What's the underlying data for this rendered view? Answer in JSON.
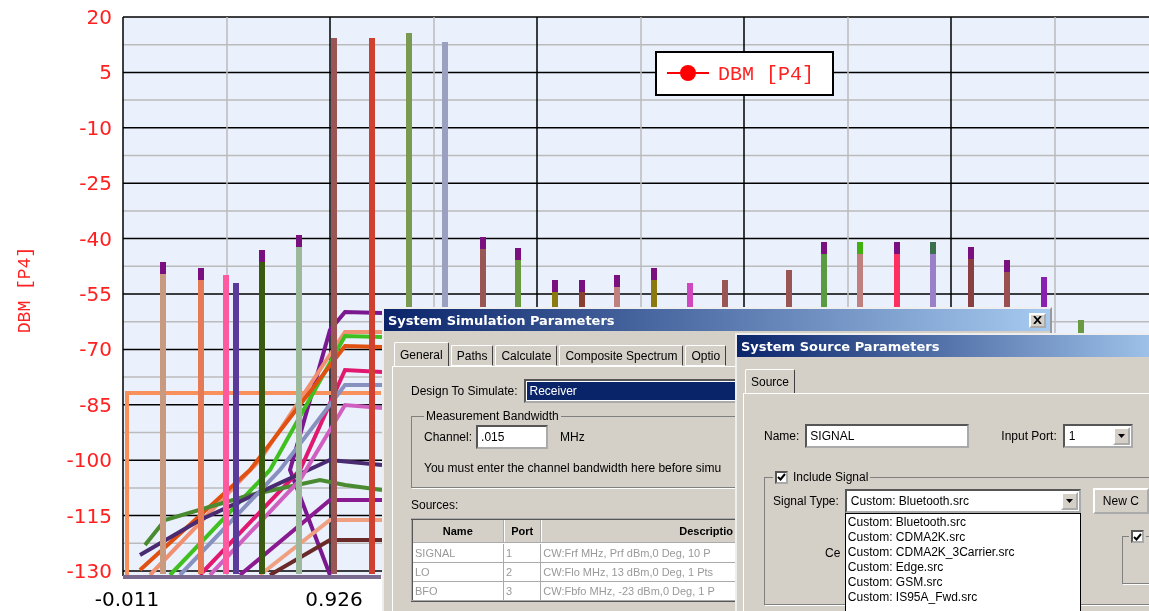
{
  "chart": {
    "y_axis_title": "DBM [P4]",
    "legend_label": "DBM [P4]",
    "y_ticks": [
      "20",
      "5",
      "-10",
      "-25",
      "-40",
      "-55",
      "-70",
      "-85",
      "-100",
      "-115",
      "-130"
    ],
    "x_ticks": [
      "-0.011",
      "0.926"
    ]
  },
  "simulation_dialog": {
    "title": "System Simulation Parameters",
    "tabs": [
      {
        "label": "General",
        "selected": true
      },
      {
        "label": "Paths",
        "selected": false
      },
      {
        "label": "Calculate",
        "selected": false
      },
      {
        "label": "Composite Spectrum",
        "selected": false
      },
      {
        "label": "Optio",
        "selected": false
      }
    ],
    "design_label": "Design To Simulate:",
    "design_value": "Receiver",
    "bandwidth_group": "Measurement Bandwidth",
    "channel_label": "Channel:",
    "channel_value": ".015",
    "channel_unit": "MHz",
    "note": "You must enter the channel bandwidth here before simu",
    "sources_label": "Sources:",
    "columns": [
      "Name",
      "Port",
      "Descriptio"
    ],
    "rows": [
      [
        "SIGNAL",
        "1",
        "CW:Frf MHz, Prf dBm,0 Deg, 10 P"
      ],
      [
        "LO",
        "2",
        "CW:Flo MHz, 13 dBm,0 Deg, 1 Pts"
      ],
      [
        "BFO",
        "3",
        "CW:Fbfo MHz, -23 dBm,0 Deg, 1 P"
      ]
    ]
  },
  "source_dialog": {
    "title": "System Source Parameters",
    "tabs": [
      {
        "label": "Source",
        "selected": true
      }
    ],
    "name_label": "Name:",
    "name_value": "SIGNAL",
    "port_label": "Input Port:",
    "port_value": "1",
    "include_label": "Include Signal",
    "include_checked": true,
    "type_label": "Signal Type:",
    "type_value": "Custom: Bluetooth.src",
    "new_button": "New C",
    "center_label": "Ce",
    "side_checked": true,
    "type_options": [
      "Custom: Bluetooth.src",
      "Custom: CDMA2K.src",
      "Custom: CDMA2K_3Carrier.src",
      "Custom: Edge.src",
      "Custom: GSM.src",
      "Custom: IS95A_Fwd.src"
    ]
  }
}
